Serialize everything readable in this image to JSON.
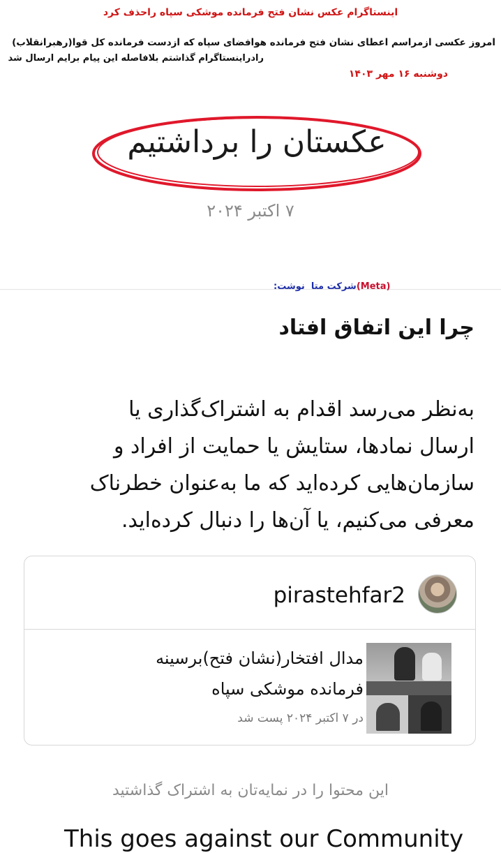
{
  "annotation": {
    "title": "اینستاگرام عکس نشان فتح  فرمانده موشکی سپاه راحذف کرد",
    "line1": "امروز  عکسی ازمراسم اعطای نشان فتح فرمانده هوافضای سپاه که ازدست فرمانده کل قوا(رهبرانقلاب)",
    "line2": "رادراینستاگرام گذاشتم بلافاصله  این پیام برایم ارسال شد",
    "date": "دوشنبه ۱۶ مهر ۱۴۰۳",
    "meta_label_red": "(Meta)",
    "meta_label_blue_a": "شرکت متا",
    "meta_label_blue_b": "نوشت:"
  },
  "notice": {
    "heading": "عکستان را برداشتیم",
    "date": "۷ اکتبر ۲۰۲۴",
    "why_heading": "چرا این اتفاق افتاد",
    "body_line1": "به‌نظر می‌رسد اقدام به اشتراک‌گذاری یا",
    "body_line2": "ارسال نمادها، ستایش یا حمایت از افراد و",
    "body_line3": "سازمان‌هایی کرده‌اید که ما به‌عنوان خطرناک",
    "body_line4": "معرفی می‌کنیم، یا آن‌ها را دنبال کرده‌اید.",
    "shared_note": "این محتوا را در نمایه‌تان به اشتراک گذاشتید",
    "bottom_en": "This goes against our Community"
  },
  "card": {
    "username": "pirastehfar2",
    "post_line1": "مدال افتخار(نشان فتح)برسینه",
    "post_line2": "فرمانده موشکی سپاه",
    "post_date": "در ۷ اکتبر ۲۰۲۴ پست شد"
  },
  "colors": {
    "annotation_red": "#d01515",
    "annotation_blue": "#1e2fa8",
    "ellipse_red": "#e0182b",
    "muted_gray": "#8a8a8a"
  },
  "icons": {
    "avatar": "profile-photo",
    "thumbnail": "post-thumbnail"
  }
}
